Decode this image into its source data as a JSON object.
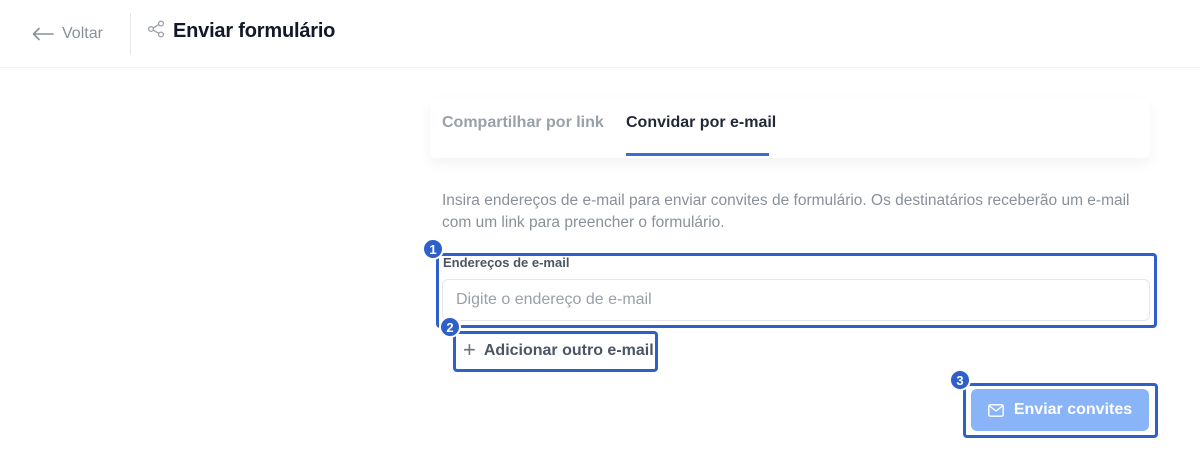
{
  "header": {
    "back_label": "Voltar",
    "title": "Enviar formulário",
    "back_icon": "arrow-left-icon",
    "share_icon": "share-icon"
  },
  "tabs": [
    {
      "label": "Compartilhar por link",
      "active": false
    },
    {
      "label": "Convidar por e-mail",
      "active": true
    }
  ],
  "invite": {
    "description": "Insira endereços de e-mail para enviar convites de formulário. Os destinatários receberão um e-mail com um link para preencher o formulário.",
    "email_label": "Endereços de e-mail",
    "email_value": "",
    "email_placeholder": "Digite o endereço de e-mail",
    "add_label": "Adicionar outro e-mail",
    "add_icon": "plus-icon",
    "send_label": "Enviar convites",
    "send_icon": "mail-icon"
  },
  "annotations": [
    "1",
    "2",
    "3"
  ],
  "colors": {
    "accent": "#3b6fd4",
    "send_button": "#8ab4f8",
    "annotation": "#2f5fc9",
    "muted_text": "#8a9099"
  }
}
